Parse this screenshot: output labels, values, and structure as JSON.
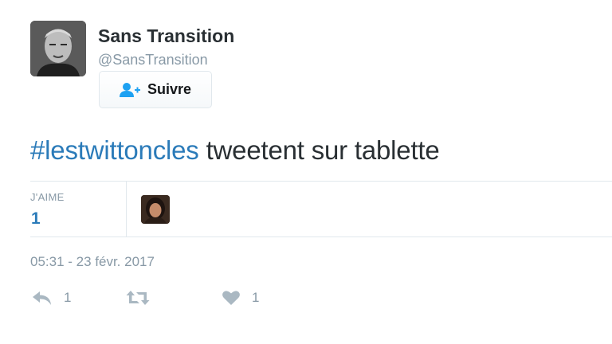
{
  "profile": {
    "display_name": "Sans Transition",
    "screen_name": "@SansTransition",
    "avatar_icon": "user-photo"
  },
  "follow_button": {
    "label": "Suivre",
    "icon": "add-user-icon"
  },
  "tweet": {
    "hashtag": "#lestwittoncles",
    "text": " tweetent sur tablette"
  },
  "stats": {
    "likes_label": "J'AIME",
    "likes_count": "1"
  },
  "timestamp": "05:31 - 23 févr. 2017",
  "actions": {
    "reply_count": "1",
    "like_count": "1"
  },
  "colors": {
    "link": "#2b7bb9",
    "muted": "#8899a6",
    "border": "#e1e8ed",
    "action_icon": "#aab8c2"
  }
}
